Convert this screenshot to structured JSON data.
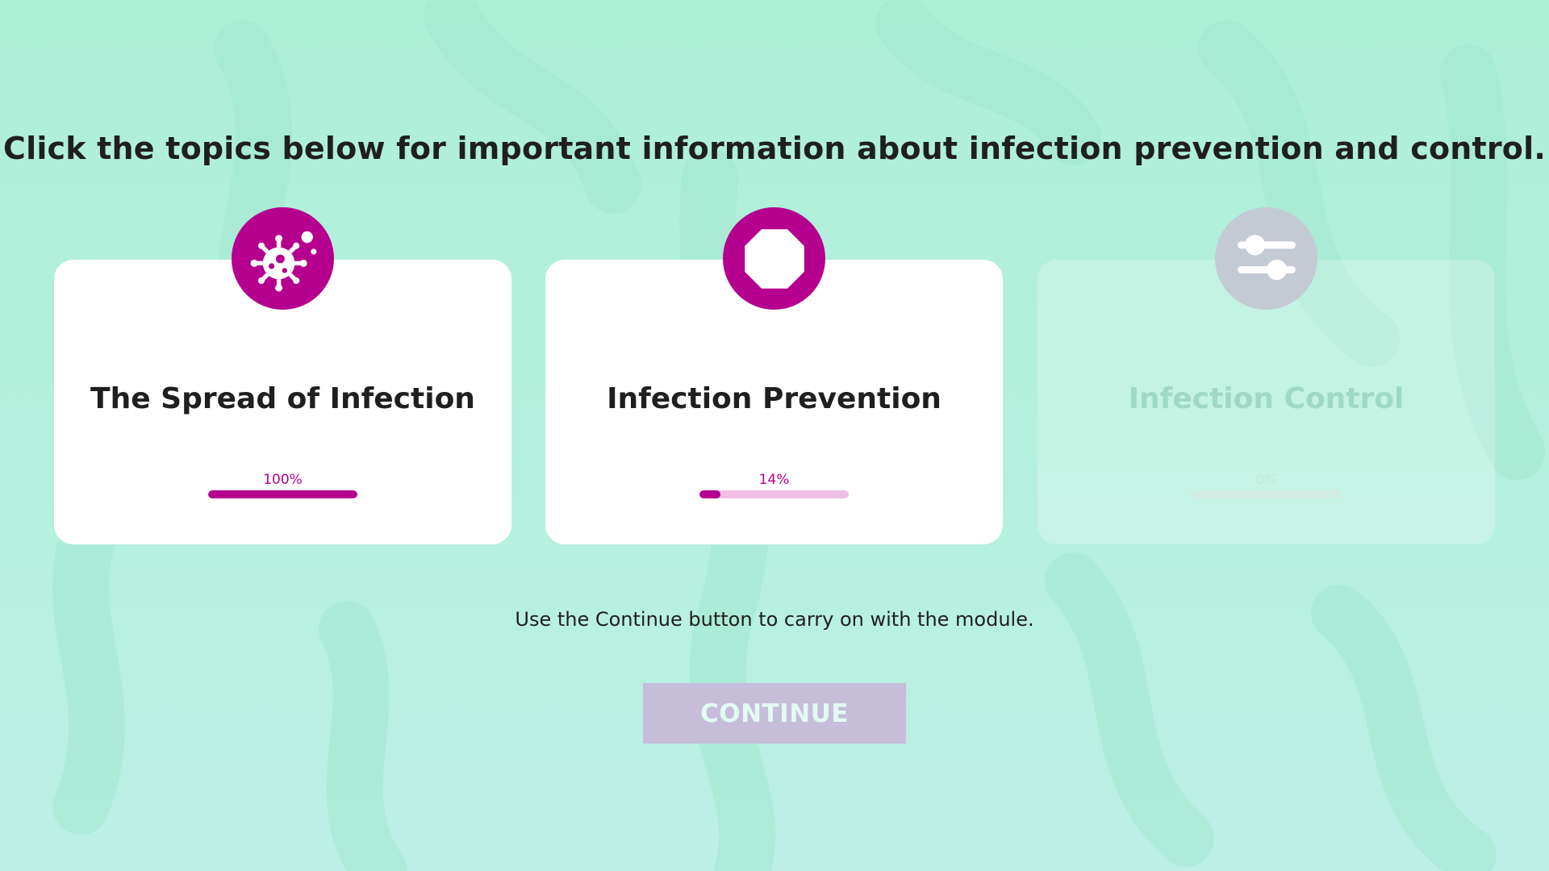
{
  "page": {
    "heading": "Click the topics below for important information about infection prevention and control.",
    "instruction": "Use the Continue button to carry on with the module.",
    "continue_label": "CONTINUE"
  },
  "topics": [
    {
      "title": "The Spread of Infection",
      "progress_label": "100%",
      "progress": 1.0,
      "icon": "virus-icon",
      "state": "completed"
    },
    {
      "title": "Infection Prevention",
      "progress_label": "14%",
      "progress": 0.14,
      "icon": "stop-octagon-icon",
      "state": "in-progress"
    },
    {
      "title": "Infection Control",
      "progress_label": "0%",
      "progress": 0.0,
      "icon": "sliders-icon",
      "state": "locked"
    }
  ],
  "colors": {
    "accent": "#b5008f",
    "background": "#aeefd8",
    "text": "#1f1f1f",
    "disabled_button": "#c6bdd9",
    "locked_icon": "#c4cad4"
  }
}
